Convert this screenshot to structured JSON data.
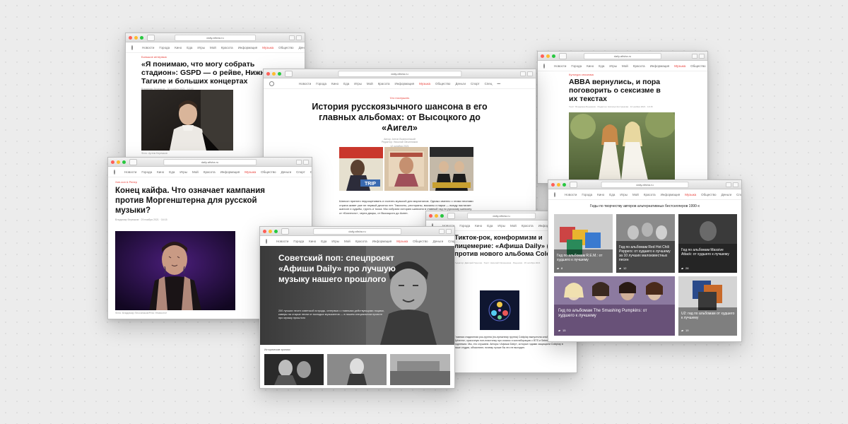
{
  "url_prefix": "",
  "nav_short": [
    "Новости",
    "Города",
    "Кино",
    "Еда",
    "Игры",
    "Мой",
    "Красота",
    "Информация",
    "Музыка",
    "Общество",
    "Деньги",
    "Спорт",
    "Спец"
  ],
  "nav_active": "Музыка",
  "w1": {
    "url": "daily.afisha.ru",
    "rubric": "Большое интервью",
    "title": "«Я понимаю, что могу собрать стадион»: GSPD — о рейве, Нижнем Тагиле и больших концертах",
    "meta": "Владимир Бережков · 30 ноября 2021 · 12:15",
    "caption": "Фото: Артем Бережков"
  },
  "w2": {
    "url": "daily.afisha.ru",
    "rubric": "Что послушать",
    "title": "История русскоязычного шансона в его главных альбомах: от Высоцкого до «Аигел»",
    "meta1": "Автор: Антон Вознесенский",
    "meta2": "Редактор: Николай Овчинников",
    "meta3": "12 октября 2021",
    "body": "Шансон принято недооценивать и считать музыкой для маргиналов. Однако именно с этими песнями страна живет уже не первый десяток лет. Таксисты, рестораны, вокзалы и парки — всюду настигает шансон и судьбы, грусть и тоска. Мы собрали историю шансона в главный гид по русскому шансону от «Блатного», через дворы, от Высоцкого до Аигел.",
    "album1": "TRIP"
  },
  "w3": {
    "url": "daily.afisha.ru",
    "rubric": "Культура сексизма",
    "title": "ABBA вернулись, и пора поговорить о сексизме в их текстах",
    "meta": "Текст: Владимир Бережков · Редактор: Наталья Кострюкова · 12 ноября 2021 · 10:15"
  },
  "w4": {
    "url": "daily.afisha.ru",
    "rubric": "Хип-хоп & Репер",
    "title": "Конец кайфа. Что означает кампания против Моргенштерна для русской музыки?",
    "meta": "Владимир Бережков · 29 ноября 2021 · 16:15",
    "caption": "Фото: Владимир Песочников/РИА «Новости»"
  },
  "w5": {
    "url": "daily.afisha.ru",
    "title": "Советский поп: спецпроект «Афиши Daily» про лучшую музыку нашего прошлого",
    "body": "200 лучших песен советской эстрады, интервью с главными действующими лицами, каверы на старые песни от молодых музыкантов — в нашем специальном проекте про музыку прошлого",
    "section": "Исторические хроники"
  },
  "w6": {
    "url": "daily.afisha.ru",
    "title": "Тикток-рок, конформизм и лицемерие: «Афиша Daily» (увы) против нового альбома Coldplay",
    "meta": "Редактор: Дмитрий Горелов · Текст: Николай Овчинников · Рецензия · 15 октября 2021",
    "body": "Главная стадионная рок-группа (по-прежнему группа) Coldplay выпустила альбом «Music of the Spheres», красочную поп-пластинку про космос и коллаборацию с BTS и Selena Gomez на подпевках. Мы, его слушаем. Авторы «Афиши Daily», которые годами защищали Coldplay в наше студии, объясняют, почему лучше бы это не выходил."
  },
  "w7": {
    "url": "daily.afisha.ru",
    "header": "Гиды по творчеству авторов альтернативных бестселлеров 1990-х",
    "cards": [
      {
        "title": "Гид по альбомам R.E.M.: от худшего к лучшему",
        "count": "8"
      },
      {
        "title": "Гид по альбомам Red Hot Chili Peppers: от худшего к лучшему за 10 лучших малоизвестных песен",
        "count": "12"
      },
      {
        "title": "Гид по альбомам Massive Attack: от худшего к лучшему",
        "count": "28"
      },
      {
        "title": "Гид по альбомам The Smashing Pumpkins: от худшего к лучшему",
        "count": "15"
      },
      {
        "title": "U2: гид по альбомам от худшего к лучшему",
        "count": "19"
      }
    ]
  }
}
